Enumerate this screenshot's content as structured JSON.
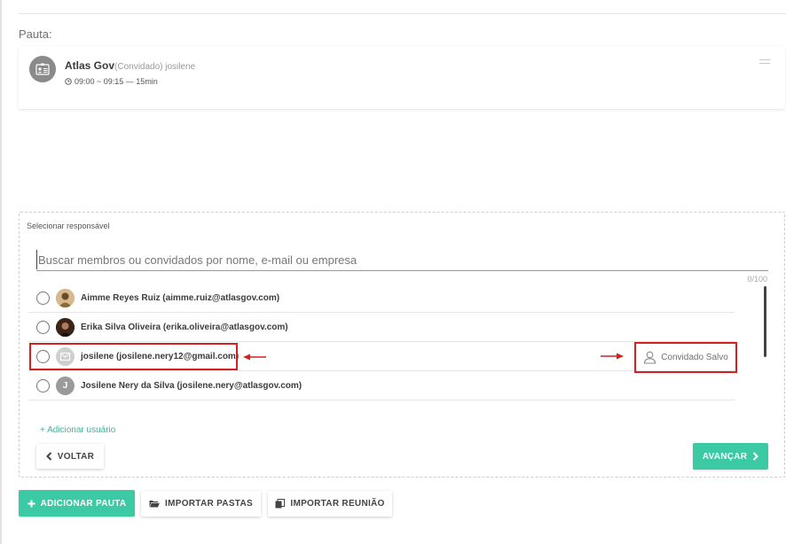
{
  "pauta_label": "Pauta:",
  "agenda_item": {
    "title": "Atlas Gov",
    "subtitle": "(Convidado) josilene",
    "time": "09:00 ~ 09:15 — 15min"
  },
  "selector": {
    "label": "Selecionar responsável",
    "search_placeholder": "Buscar membros ou convidados por nome, e-mail ou empresa",
    "search_value": "",
    "counter": "0/100",
    "users": [
      {
        "name": "Aimme Reyes Ruiz (aimme.ruiz@atlasgov.com)",
        "avatar": "photo"
      },
      {
        "name": "Erika Silva Oliveira (erika.oliveira@atlasgov.com)",
        "avatar": "photo"
      },
      {
        "name": "josilene (josilene.nery12@gmail.com)",
        "avatar": "envelope-icon"
      },
      {
        "name": "Josilene Nery da Silva (josilene.nery@atlasgov.com)",
        "avatar": "J"
      }
    ],
    "saved_guest_label": "Convidado Salvo",
    "add_user_label": "+ Adicionar usuário",
    "back_label": "VOLTAR",
    "next_label": "AVANÇAR"
  },
  "actions": {
    "add_agenda": "ADICIONAR PAUTA",
    "import_folders": "IMPORTAR PASTAS",
    "import_meeting": "IMPORTAR REUNIÃO"
  },
  "colors": {
    "accent": "#3ccaa5",
    "annotation": "#d32020"
  }
}
